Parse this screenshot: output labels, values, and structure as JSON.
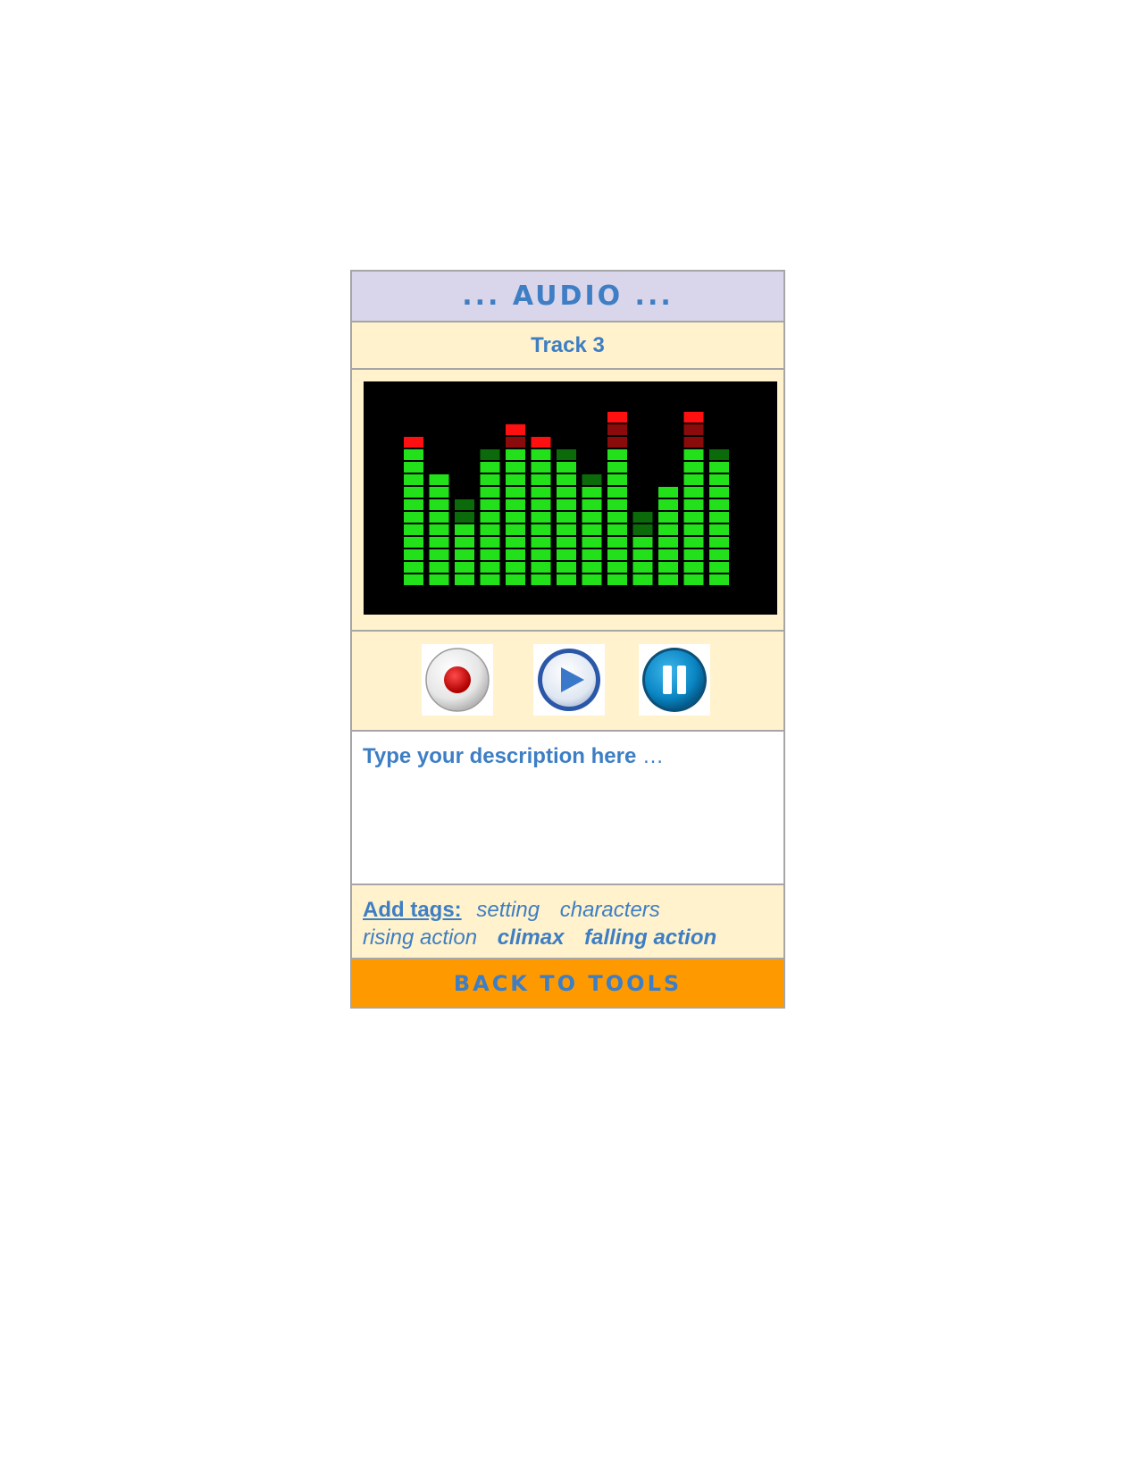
{
  "panel": {
    "title": "... AUDIO ...",
    "track_name": "Track 3"
  },
  "visualizer": {
    "label": "audio-level-meter",
    "colors": {
      "background": "#000000",
      "green_on": "#22e01a",
      "green_dim": "#0b6b0b",
      "red_on": "#ff1010",
      "red_dim": "#8a0b0b"
    },
    "max_segments": 14,
    "bars": [
      {
        "level": 11,
        "peak": 12
      },
      {
        "level": 9,
        "peak": 9
      },
      {
        "level": 5,
        "peak": 7
      },
      {
        "level": 10,
        "peak": 11
      },
      {
        "level": 11,
        "peak": 13
      },
      {
        "level": 11,
        "peak": 12
      },
      {
        "level": 10,
        "peak": 11
      },
      {
        "level": 8,
        "peak": 9
      },
      {
        "level": 11,
        "peak": 14
      },
      {
        "level": 4,
        "peak": 6
      },
      {
        "level": 8,
        "peak": 8
      },
      {
        "level": 11,
        "peak": 14
      },
      {
        "level": 10,
        "peak": 11
      }
    ]
  },
  "controls": {
    "record_icon": "record-icon",
    "play_icon": "play-icon",
    "pause_icon": "pause-icon"
  },
  "description": {
    "placeholder_text": "Type your description here",
    "placeholder_ellipsis": " …"
  },
  "tags": {
    "label": "Add tags:",
    "items": [
      {
        "label": "setting",
        "bold": false
      },
      {
        "label": "characters",
        "bold": false
      },
      {
        "label": "rising action",
        "bold": false
      },
      {
        "label": "climax",
        "bold": true
      },
      {
        "label": "falling action",
        "bold": true
      }
    ]
  },
  "footer": {
    "back_label": "BACK TO TOOLS",
    "accent": "#ff9900"
  }
}
